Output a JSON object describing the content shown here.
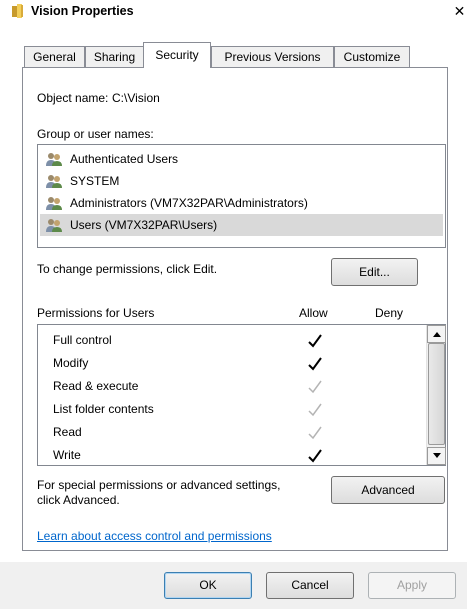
{
  "window": {
    "title": "Vision Properties",
    "close_glyph": "✕"
  },
  "tabs": [
    {
      "label": "General"
    },
    {
      "label": "Sharing"
    },
    {
      "label": "Security",
      "active": true
    },
    {
      "label": "Previous Versions"
    },
    {
      "label": "Customize"
    }
  ],
  "security": {
    "object_name_label": "Object name:",
    "object_name_value": "C:\\Vision",
    "group_label": "Group or user names:",
    "users": [
      {
        "name": "Authenticated Users",
        "icon": "users-icon"
      },
      {
        "name": "SYSTEM",
        "icon": "users-icon"
      },
      {
        "name": "Administrators (VM7X32PAR\\Administrators)",
        "icon": "users-icon"
      },
      {
        "name": "Users (VM7X32PAR\\Users)",
        "icon": "users-icon",
        "selected": true
      }
    ],
    "change_hint": "To change permissions, click Edit.",
    "edit_button": "Edit...",
    "permissions_header": "Permissions for Users",
    "allow_header": "Allow",
    "deny_header": "Deny",
    "permissions": [
      {
        "name": "Full control",
        "allow": "explicit"
      },
      {
        "name": "Modify",
        "allow": "explicit"
      },
      {
        "name": "Read & execute",
        "allow": "inherited"
      },
      {
        "name": "List folder contents",
        "allow": "inherited"
      },
      {
        "name": "Read",
        "allow": "inherited"
      },
      {
        "name": "Write",
        "allow": "explicit"
      }
    ],
    "advanced_hint_line1": "For special permissions or advanced settings,",
    "advanced_hint_line2": "click Advanced.",
    "advanced_button": "Advanced",
    "learn_link": "Learn about access control and permissions"
  },
  "buttons": {
    "ok": "OK",
    "cancel": "Cancel",
    "apply": "Apply"
  },
  "colors": {
    "link": "#0066cc",
    "selection": "#d9d9d9",
    "check_explicit": "#000000",
    "check_inherited": "#b4b4b4"
  }
}
